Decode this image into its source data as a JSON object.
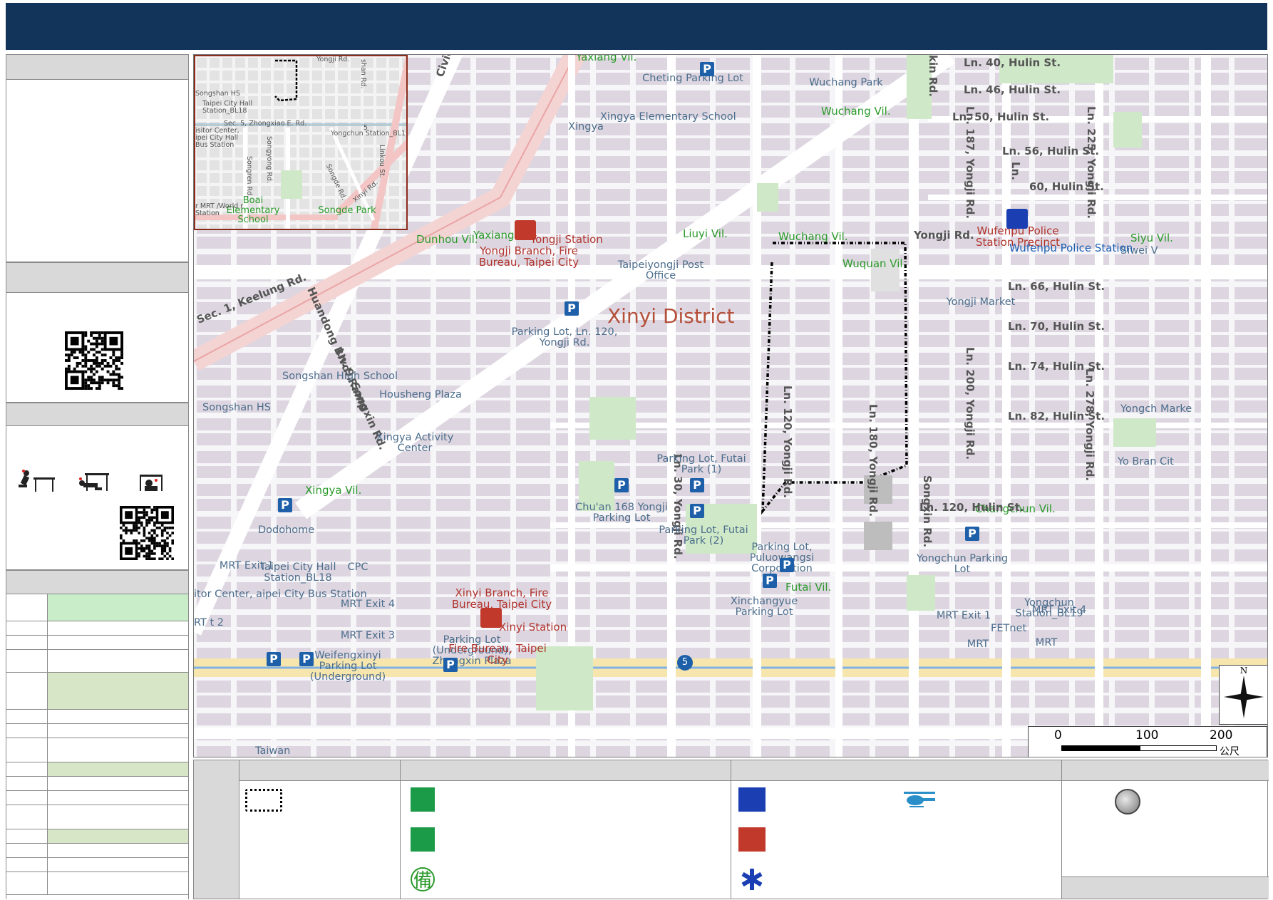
{
  "map": {
    "district": "Xinyi District",
    "villages": [
      "Yaxiang Vil.",
      "Wuchang Vil.",
      "Liuyi Vil.",
      "Siyu Vil.",
      "Dunhou Vil.",
      "Yaxiang Vil.",
      "Wuquan Vil.",
      "Xingya Vil.",
      "Changchun Vil.",
      "Futai Vil.",
      "Wuchang Vil."
    ],
    "streets": [
      "Ln. 40, Hulin St.",
      "Ln. 46, Hulin St.",
      "Ln. 50, Hulin St.",
      "Ln. 56, Hulin St.",
      "Ln.",
      "60, Hulin St.",
      "Ln. 66, Hulin St.",
      "Ln. 70, Hulin St.",
      "Ln. 74, Hulin St.",
      "Ln. 82, Hulin St.",
      "Ln. 120, Hulin St.",
      "Yongji Rd.",
      "Ln. 187, Yongji Rd.",
      "Ln. 225, Yongji Rd.",
      "Ln. 200, Yongji Rd.",
      "Ln. 278, Yongji Rd.",
      "Ln. 120, Yongji Rd.",
      "Ln. 180, Yongji Rd.",
      "Ln. 30, Yongji Rd.",
      "Songxin Rd.",
      "Civic Blvd. Viaduct",
      "Sec. 1, Keelung Rd.",
      "Huandong Blvd. Ramp",
      "Ln. 9, Songxin Rd.",
      "kin Rd."
    ],
    "pois": [
      "Cheting Parking Lot",
      "Xingya Elementary School",
      "Xingya",
      "Wuchang Park",
      "Taipeiyongji Post Office",
      "Parking Lot, Ln. 120, Yongji Rd.",
      "Songshan High School",
      "Songshan HS",
      "Housheng Plaza",
      "Xingya Activity Center",
      "Yongji Market",
      "Parking Lot, Futai Park (1)",
      "Chu'an 168 Yongji Parking Lot",
      "Parking Lot, Futai Park (2)",
      "Dodohome",
      "Parking Lot, Puluowangsi Corporation",
      "Yongchun Parking Lot",
      "Xinchangyue Parking Lot",
      "MRT Exit 1",
      "Taipei City Hall Station_BL18",
      "CPC",
      "MRT Exit 4",
      "MRT Exit 3",
      "itor Center, aipei City Bus Station",
      "RT t 2",
      "Weifengxinyi Parking Lot (Underground)",
      "Parking Lot (Underground), Zhongxin Plaza",
      "Yongchun Station_BL19",
      "MRT Exit 1",
      "FETnet",
      "MRT Exit 4",
      "MRT",
      "MRT",
      "Yongch Marke",
      "Yo Bran Cit",
      "Siwei V",
      "Taiwan"
    ],
    "fire": [
      "Yongji Station",
      "Yongji Branch, Fire Bureau, Taipei City",
      "Xinyi Branch, Fire Bureau, Taipei City",
      "Xinyi Station",
      "Fire Bureau, Taipei City"
    ],
    "police": [
      "Wufenpu Police Station",
      "Wufenpu Police Station Precinct"
    ],
    "scale": {
      "labels": [
        "0",
        "100",
        "200"
      ],
      "unit": "公尺"
    },
    "north": "N",
    "route_badge": "5"
  },
  "inset": {
    "labels": [
      "Yongji Rd.",
      "shan Rd.",
      "Songshan HS",
      "Taipei City Hall Station_BL18",
      "Sec. 5, Zhongxiao E. Rd.",
      "isitor Center, ipei City Hall Bus Station",
      "Yongchun Station_BL19",
      "Songyong Rd.",
      "Songren Rd.",
      "Linkou St.",
      "Songde Rd.",
      "Xinyi Rd.",
      "Boai Elementary School",
      "Songde Park",
      "r MRT /World r Station",
      "5"
    ]
  },
  "colors": {
    "header": "#13345a",
    "boundary": "#000000",
    "village": "#2b9a2b",
    "fire": "#c0392b",
    "police": "#1b3fb3",
    "parking": "#1d5fa8",
    "shelter": "#1b9a47"
  },
  "legend": {
    "icons": [
      "boundary-icon",
      "shelter-icon",
      "evacuation-park-icon",
      "backup-shelter-icon",
      "police-icon",
      "fire-icon",
      "medical-icon",
      "helicopter-icon",
      "assembly-point-icon"
    ],
    "backup_glyph": "備"
  }
}
